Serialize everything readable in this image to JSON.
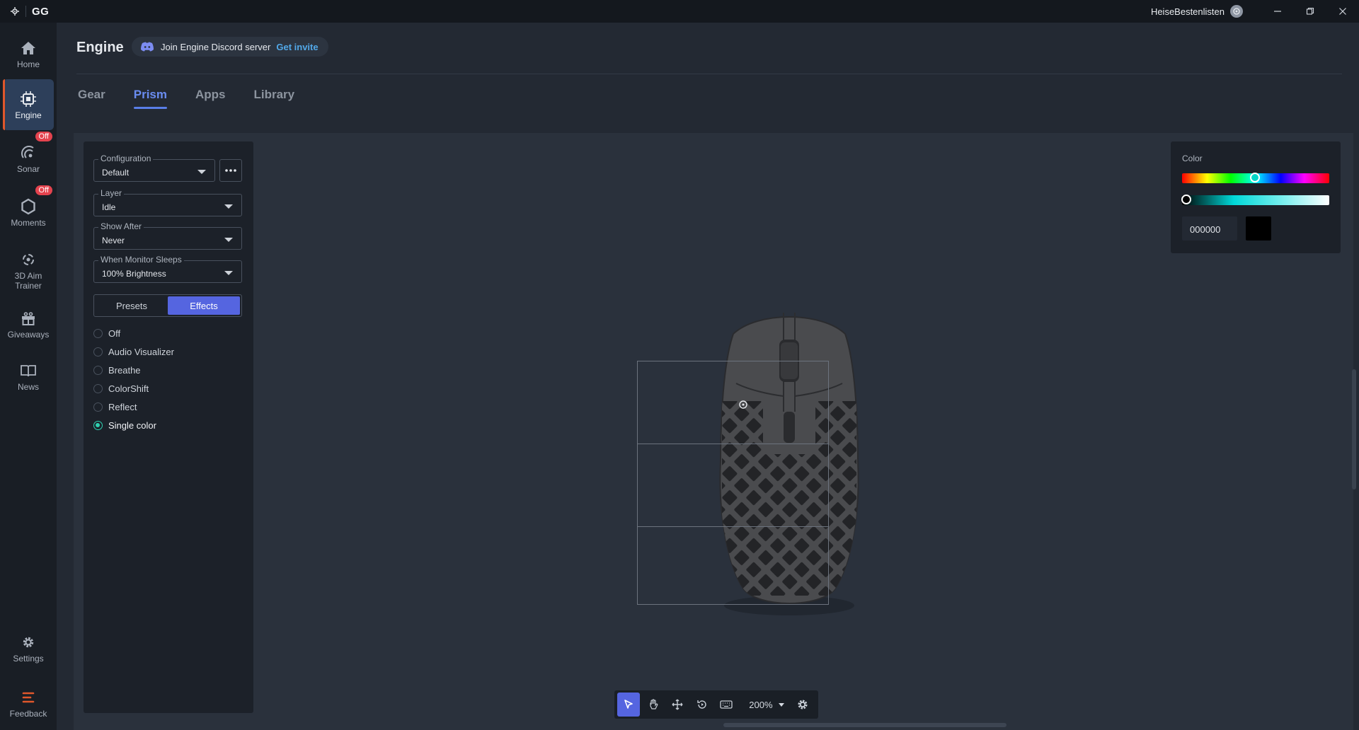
{
  "titlebar": {
    "app_name": "GG",
    "username": "HeiseBestenlisten",
    "minimize_icon": "minimize-icon",
    "restore_icon": "restore-icon",
    "close_icon": "close-icon"
  },
  "nav": {
    "items": [
      {
        "label": "Home",
        "icon": "home-icon"
      },
      {
        "label": "Engine",
        "icon": "chip-icon",
        "active": true
      },
      {
        "label": "Sonar",
        "icon": "sonar-icon",
        "badge": "Off"
      },
      {
        "label": "Moments",
        "icon": "hexagon-icon",
        "badge": "Off"
      },
      {
        "label": "3D Aim Trainer",
        "icon": "aim-icon"
      },
      {
        "label": "Giveaways",
        "icon": "gift-icon"
      },
      {
        "label": "News",
        "icon": "book-icon"
      }
    ],
    "bottom": [
      {
        "label": "Settings",
        "icon": "gear-icon"
      },
      {
        "label": "Feedback",
        "icon": "feedback-icon"
      }
    ]
  },
  "header": {
    "title": "Engine",
    "discord_text": "Join Engine Discord server",
    "discord_link": "Get invite"
  },
  "tabs": [
    "Gear",
    "Prism",
    "Apps",
    "Library"
  ],
  "active_tab": "Prism",
  "left_panel": {
    "configuration": {
      "label": "Configuration",
      "value": "Default"
    },
    "layer": {
      "label": "Layer",
      "value": "Idle"
    },
    "show_after": {
      "label": "Show After",
      "value": "Never"
    },
    "monitor_sleeps": {
      "label": "When Monitor Sleeps",
      "value": "100% Brightness"
    },
    "segments": {
      "presets": "Presets",
      "effects": "Effects",
      "active": "Effects"
    },
    "effects": [
      "Off",
      "Audio Visualizer",
      "Breathe",
      "ColorShift",
      "Reflect",
      "Single color"
    ],
    "selected_effect": "Single color"
  },
  "color_panel": {
    "label": "Color",
    "hex_value": "000000",
    "swatch_color": "#000000"
  },
  "toolbar": {
    "zoom_label": "200%"
  },
  "colors": {
    "accent": "#5565e0",
    "active_radio": "#2ed1b0",
    "badge": "#e4434e",
    "nav_indicator": "#e0572b"
  }
}
